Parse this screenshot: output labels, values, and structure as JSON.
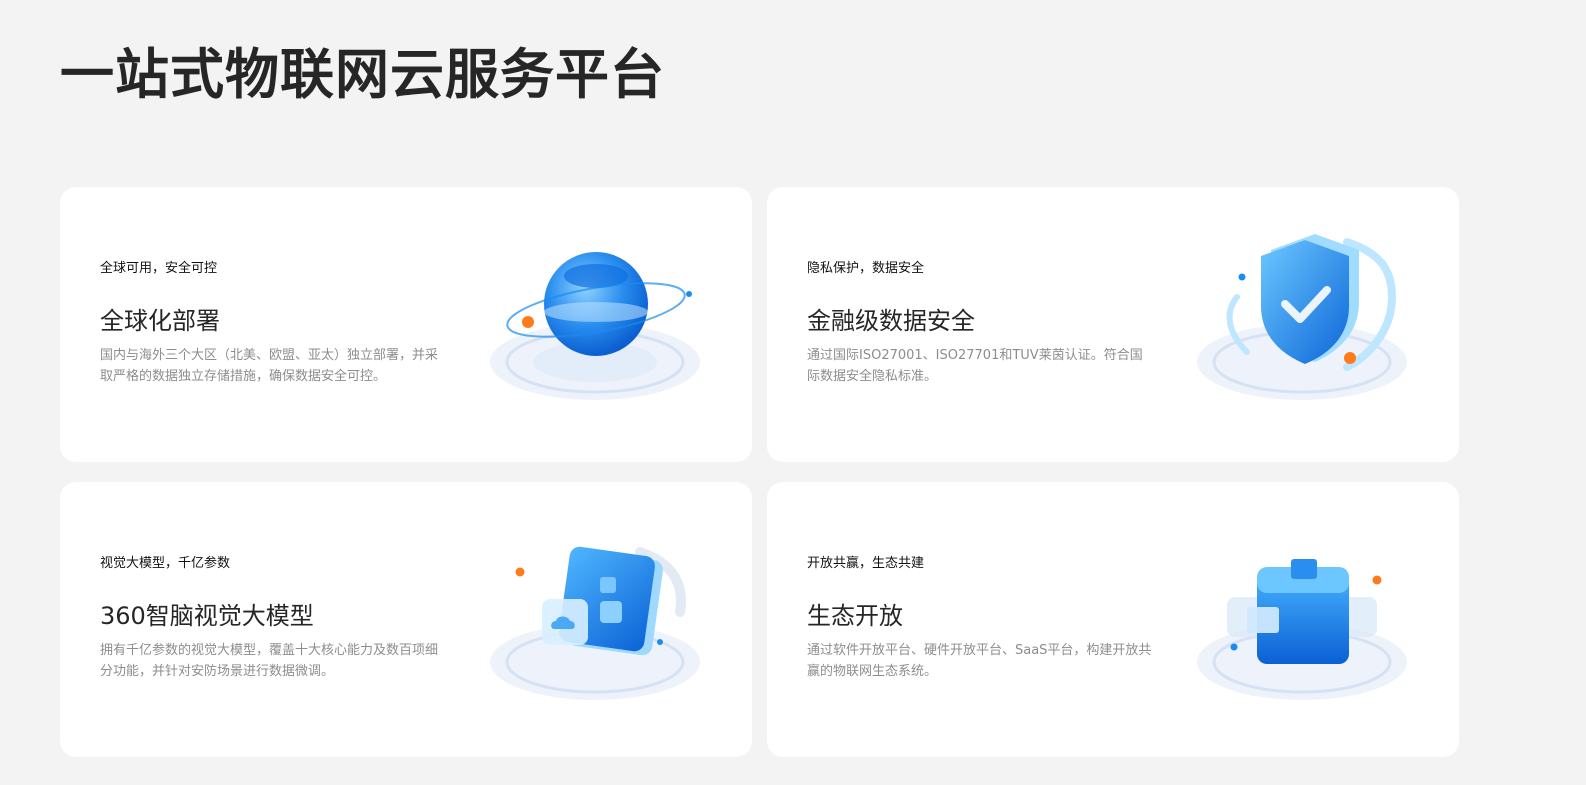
{
  "page": {
    "title": "一站式物联网云服务平台"
  },
  "cards": [
    {
      "tag": "全球可用，安全可控",
      "title": "全球化部署",
      "desc": "国内与海外三个大区（北美、欧盟、亚太）独立部署，并采取严格的数据独立存储措施，确保数据安全可控。",
      "icon": "globe-icon"
    },
    {
      "tag": "隐私保护，数据安全",
      "title": "金融级数据安全",
      "desc": "通过国际ISO27001、ISO27701和TUV莱茵认证。符合国际数据安全隐私标准。",
      "icon": "shield-check-icon"
    },
    {
      "tag": "视觉大模型，千亿参数",
      "title": "360智脑视觉大模型",
      "desc": "拥有千亿参数的视觉大模型，覆盖十大核心能力及数百项细分功能，并针对安防场景进行数据微调。",
      "icon": "ai-panel-icon"
    },
    {
      "tag": "开放共赢，生态共建",
      "title": "生态开放",
      "desc": "通过软件开放平台、硬件开放平台、SaaS平台，构建开放共赢的物联网生态系统。",
      "icon": "cube-icon"
    }
  ],
  "colors": {
    "background": "#f3f3f3",
    "card": "#ffffff",
    "accent_blue": "#1a8cf0",
    "accent_orange": "#ff7a1a"
  }
}
